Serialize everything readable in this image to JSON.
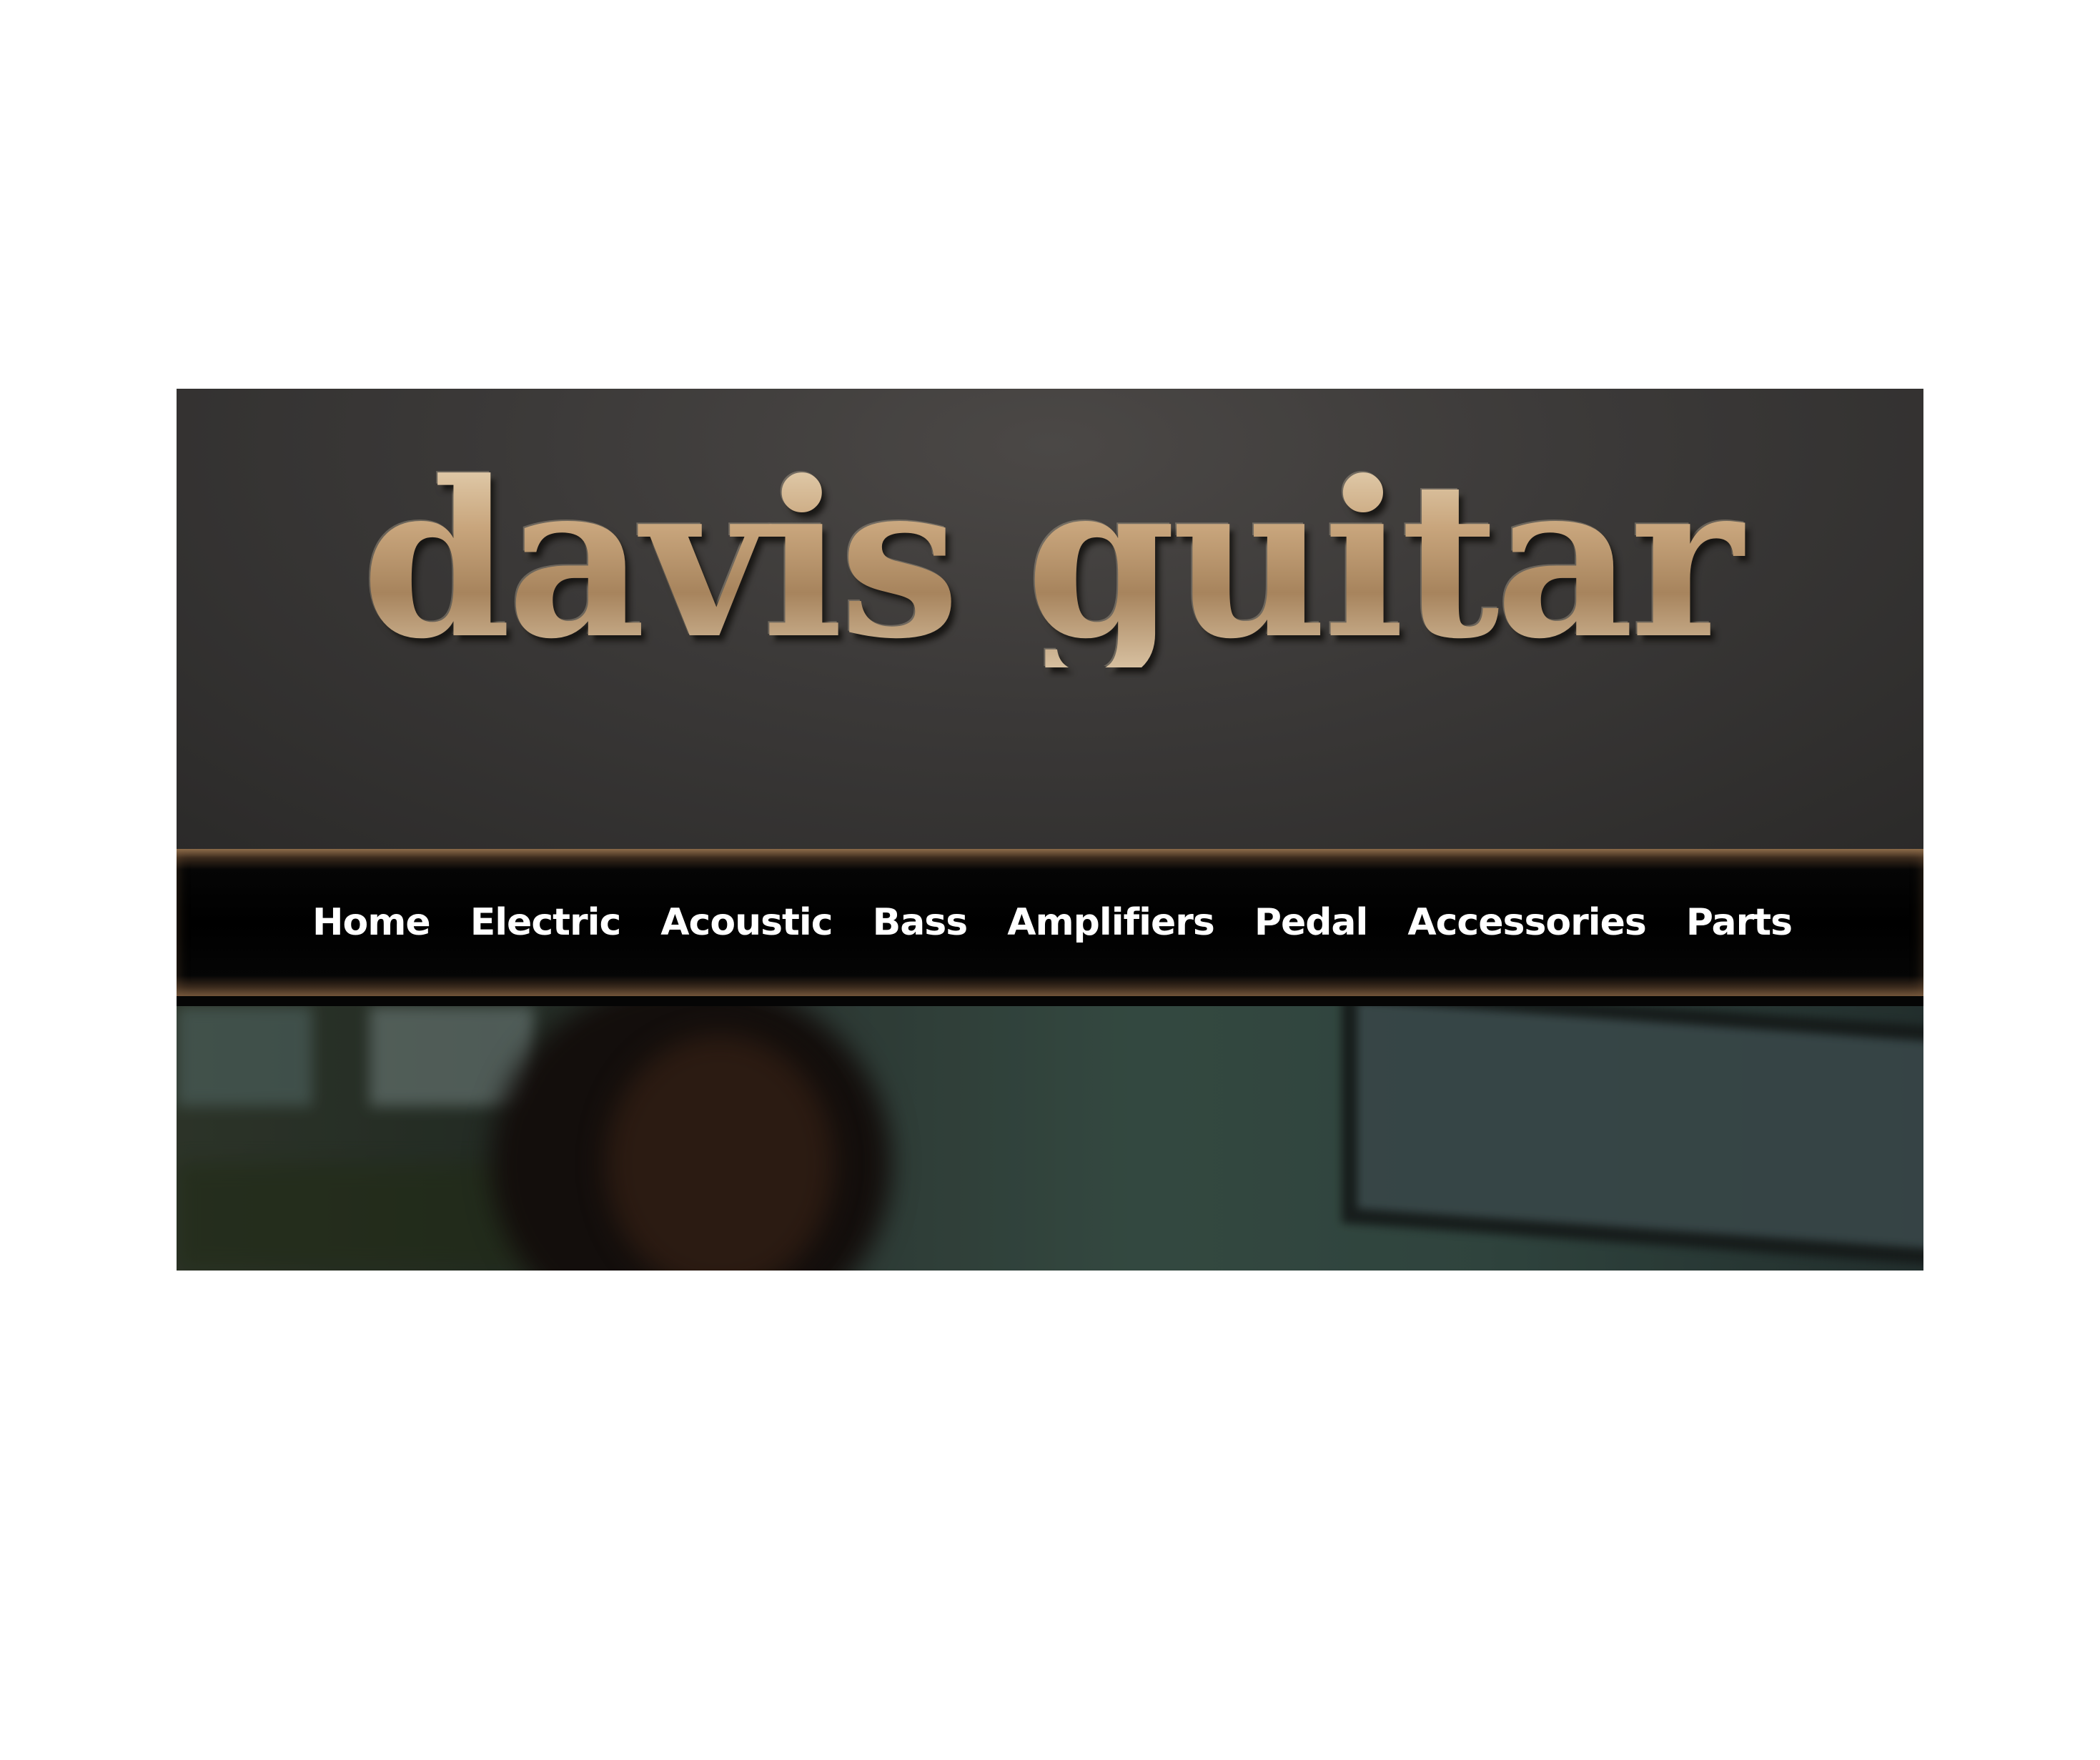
{
  "header": {
    "logo_text": "davis guitar"
  },
  "nav": {
    "items": [
      {
        "label": "Home"
      },
      {
        "label": "Electric"
      },
      {
        "label": "Acoustic"
      },
      {
        "label": "Bass"
      },
      {
        "label": "Amplifiers"
      },
      {
        "label": "Pedal"
      },
      {
        "label": "Accessories"
      },
      {
        "label": "Parts"
      }
    ]
  },
  "colors": {
    "header_background": "#3b3938",
    "logo_metal": "#cdb089",
    "nav_background": "#000000",
    "nav_border": "#8a6a4a",
    "nav_text": "#ffffff"
  }
}
